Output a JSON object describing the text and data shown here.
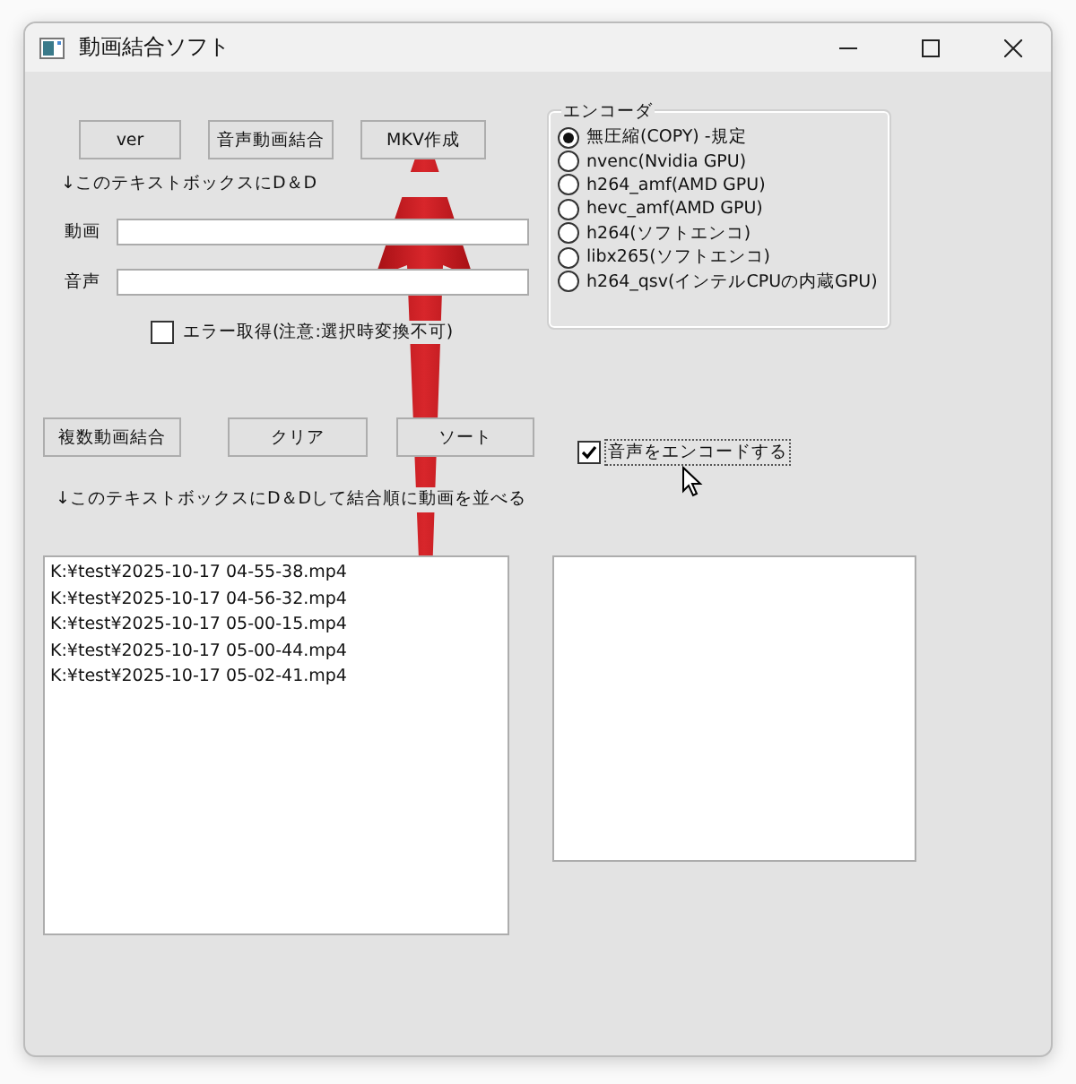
{
  "window": {
    "title": "動画結合ソフト"
  },
  "top_buttons": [
    "ver",
    "音声動画結合",
    "MKV作成"
  ],
  "dnd_hint": "↓このテキストボックスにD＆D",
  "fields": [
    {
      "label": "動画"
    },
    {
      "label": "音声"
    }
  ],
  "error_checkbox": {
    "label": "エラー取得(注意:選択時変換不可)",
    "checked": false
  },
  "encoder": {
    "title": "エンコーダ",
    "options": [
      {
        "label": "無圧縮(COPY) -規定",
        "selected": true
      },
      {
        "label": "nvenc(Nvidia GPU)",
        "selected": false
      },
      {
        "label": "h264_amf(AMD GPU)",
        "selected": false
      },
      {
        "label": "hevc_amf(AMD GPU)",
        "selected": false
      },
      {
        "label": "h264(ソフトエンコ)",
        "selected": false
      },
      {
        "label": "libx265(ソフトエンコ)",
        "selected": false
      },
      {
        "label": "h264_qsv(インテルCPUの内蔵GPU)",
        "selected": false
      }
    ]
  },
  "middle_buttons": [
    "複数動画結合",
    "クリア",
    "ソート"
  ],
  "audio_checkbox": {
    "label": "音声をエンコードする",
    "checked": true
  },
  "list_hint": "↓このテキストボックスにD＆Dして結合順に動画を並べる",
  "file_list": [
    "K:¥test¥2025-10-17 04-55-38.mp4",
    "K:¥test¥2025-10-17 04-56-32.mp4",
    "K:¥test¥2025-10-17 05-00-15.mp4",
    "K:¥test¥2025-10-17 05-00-44.mp4",
    "K:¥test¥2025-10-17 05-02-41.mp4"
  ]
}
